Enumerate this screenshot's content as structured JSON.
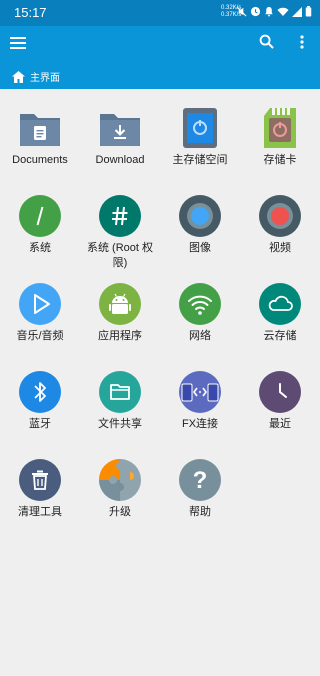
{
  "status_bar": {
    "time": "15:17",
    "speed_up": "0.32K/s",
    "speed_down": "0.37K/s"
  },
  "breadcrumb": {
    "label": "主界面"
  },
  "colors": {
    "status_bar": "#0a7fbd",
    "app_bar": "#0a95d9",
    "background": "#efefef"
  },
  "items": [
    {
      "label": "Documents",
      "icon": "documents-folder-icon"
    },
    {
      "label": "Download",
      "icon": "download-folder-icon"
    },
    {
      "label": "主存储空间",
      "icon": "phone-storage-icon"
    },
    {
      "label": "存储卡",
      "icon": "sd-card-icon"
    },
    {
      "label": "系统",
      "icon": "system-slash-icon"
    },
    {
      "label": "系统 (Root 权限)",
      "icon": "root-hash-icon"
    },
    {
      "label": "图像",
      "icon": "images-icon"
    },
    {
      "label": "视频",
      "icon": "videos-icon"
    },
    {
      "label": "音乐/音频",
      "icon": "music-play-icon"
    },
    {
      "label": "应用程序",
      "icon": "android-apps-icon"
    },
    {
      "label": "网络",
      "icon": "wifi-network-icon"
    },
    {
      "label": "云存储",
      "icon": "cloud-icon"
    },
    {
      "label": "蓝牙",
      "icon": "bluetooth-icon"
    },
    {
      "label": "文件共享",
      "icon": "file-share-folder-icon"
    },
    {
      "label": "FX连接",
      "icon": "fx-connect-icon"
    },
    {
      "label": "最近",
      "icon": "recent-clock-icon"
    },
    {
      "label": "清理工具",
      "icon": "trash-cleaner-icon"
    },
    {
      "label": "升级",
      "icon": "upgrade-puzzle-icon"
    },
    {
      "label": "帮助",
      "icon": "help-question-icon"
    }
  ]
}
